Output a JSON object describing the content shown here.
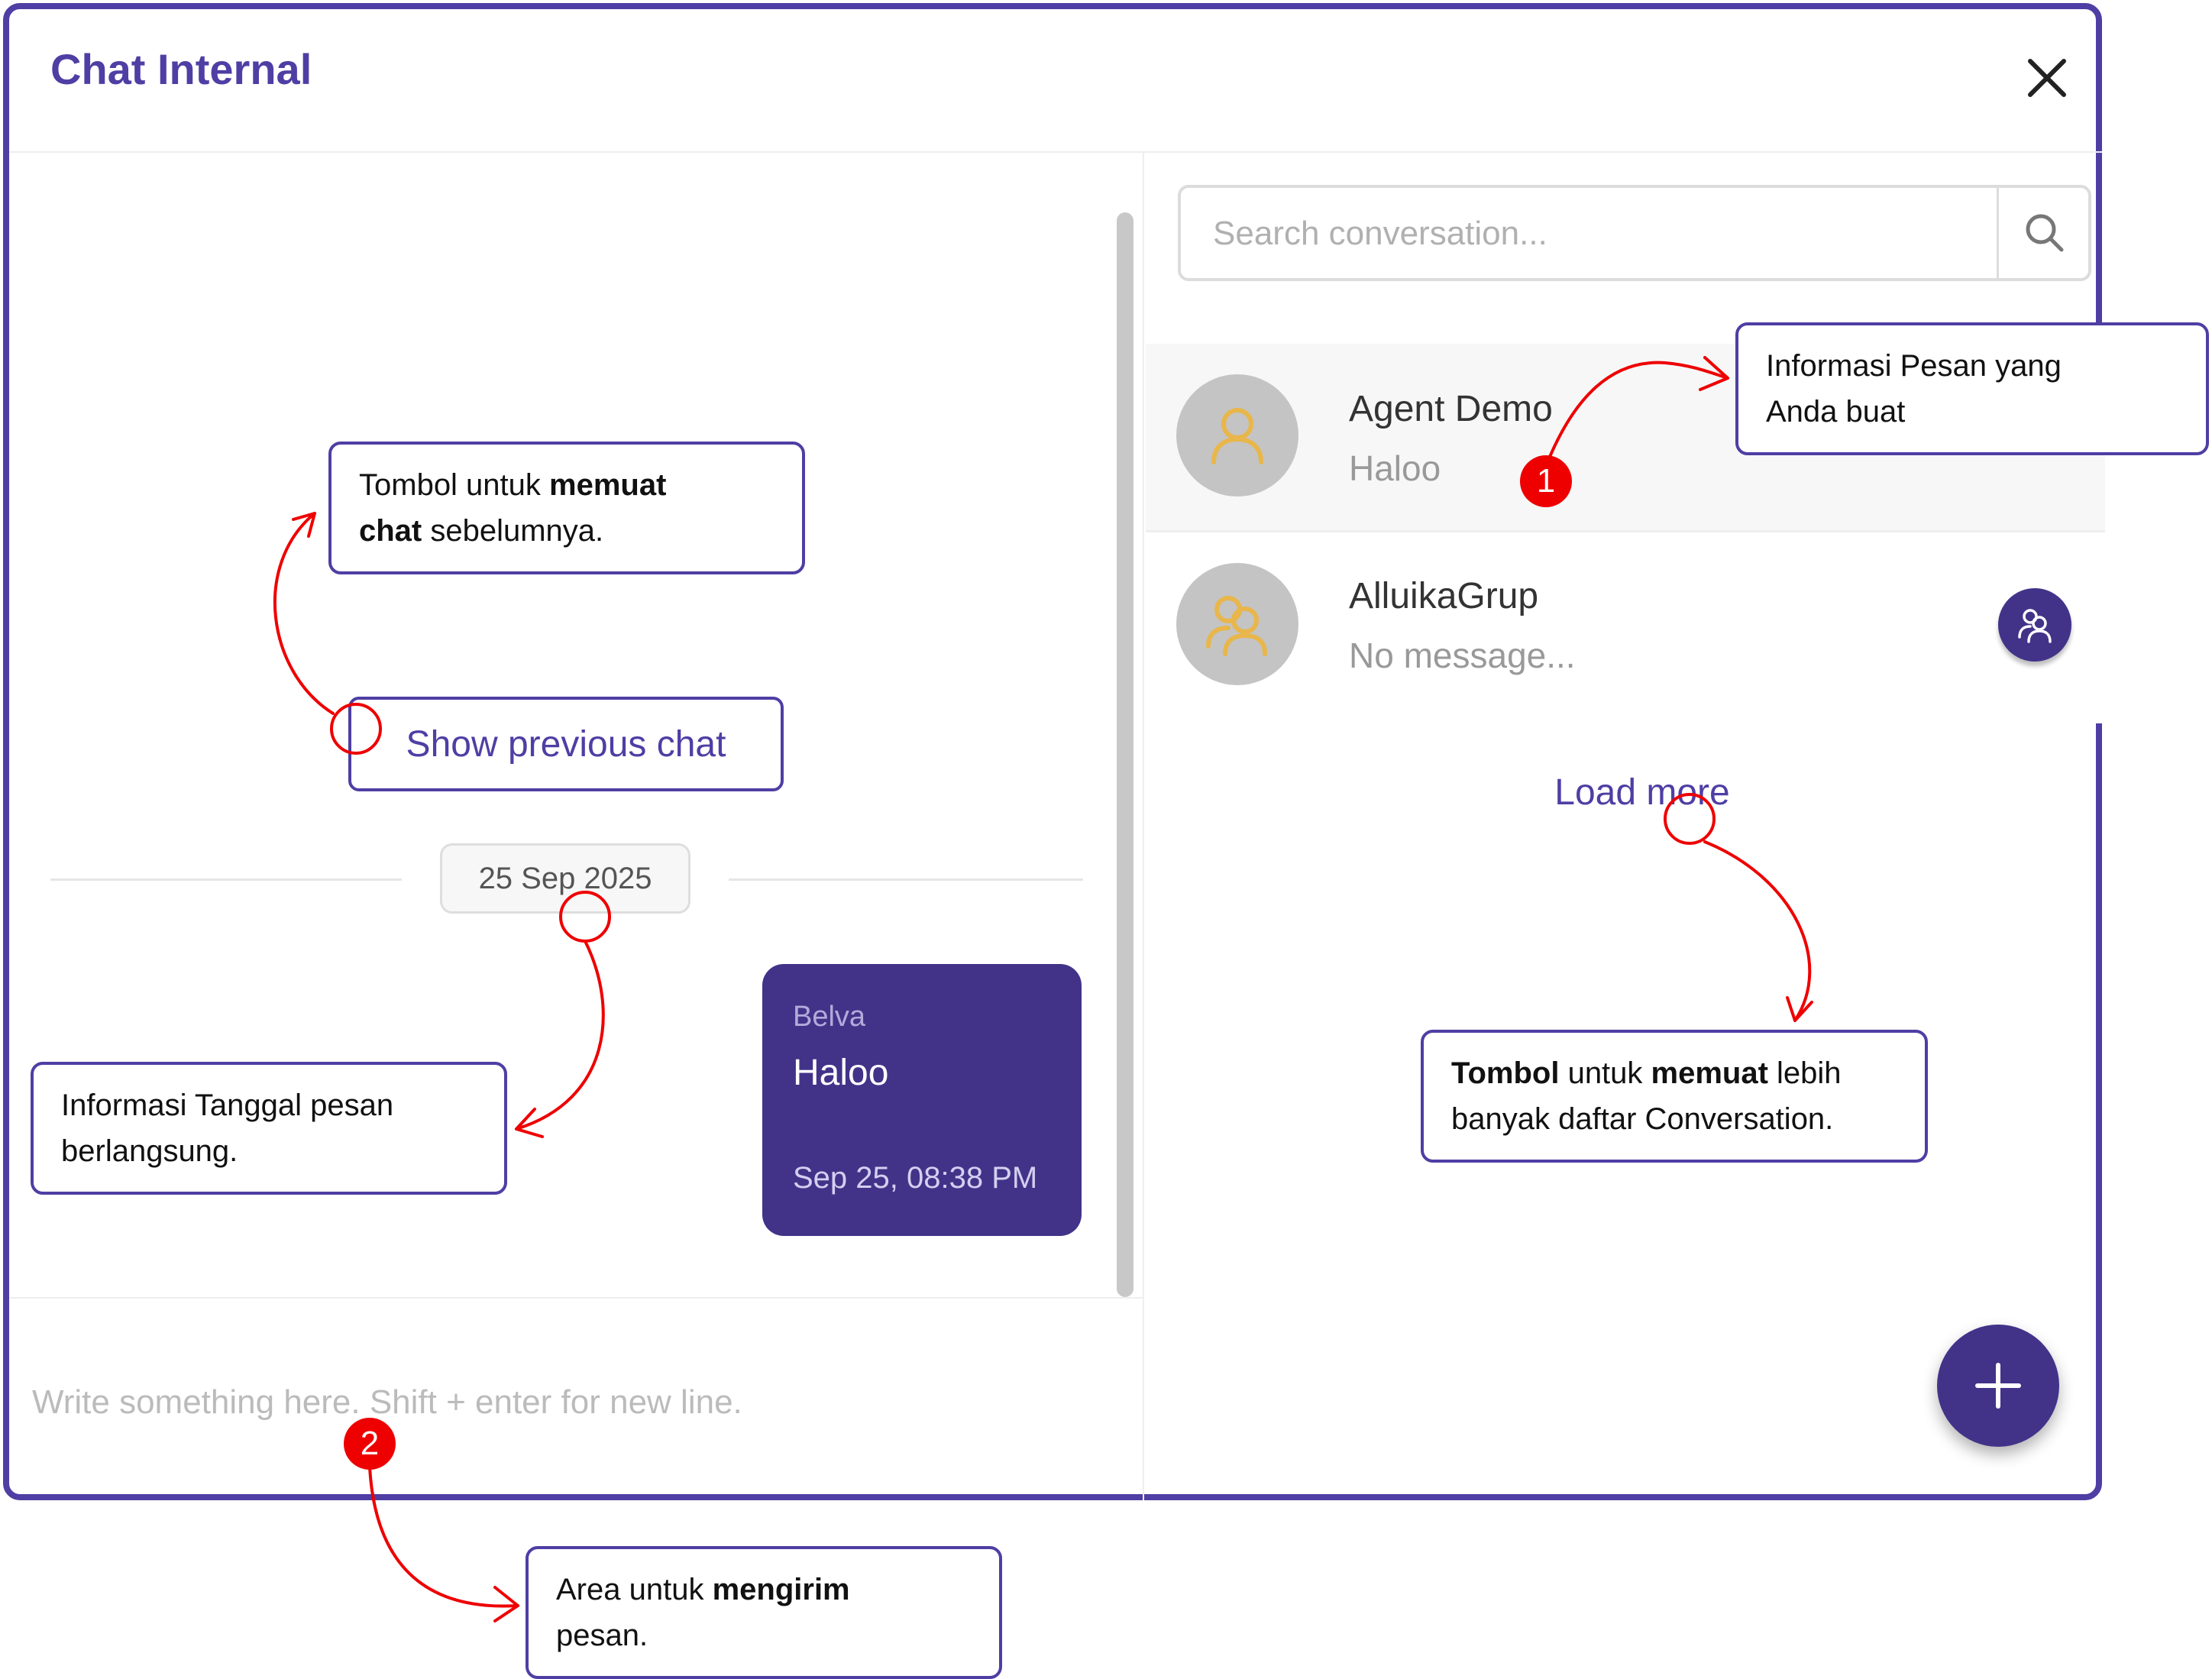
{
  "window": {
    "title": "Chat Internal",
    "close_icon": "close-icon"
  },
  "chat": {
    "show_previous_label": "Show previous chat",
    "date_badge": "25 Sep 2025",
    "message": {
      "sender": "Belva",
      "text": "Haloo",
      "time": "Sep 25, 08:38 PM"
    },
    "input_placeholder": "Write something here. Shift + enter for new line."
  },
  "conversations": {
    "search_placeholder": "Search conversation...",
    "search_icon": "search-icon",
    "items": [
      {
        "name": "Agent Demo",
        "preview": "Haloo",
        "avatar_icon": "user-icon"
      },
      {
        "name": "AlluikaGrup",
        "preview": "No message...",
        "avatar_icon": "group-icon"
      }
    ],
    "group_button_icon": "group-icon",
    "load_more_label": "Load more",
    "new_conversation_icon": "plus-icon"
  },
  "annotations": {
    "info_message": {
      "text_1": "Informasi Pesan yang",
      "text_2": "Anda buat"
    },
    "load_prev": {
      "a": "Tombol untuk ",
      "b": "memuat",
      "c": "chat",
      "d": " sebelumnya."
    },
    "date_info": {
      "text_1": "Informasi Tanggal pesan",
      "text_2": "berlangsung."
    },
    "load_more": {
      "a": "Tombol",
      "b": " untuk ",
      "c": "memuat",
      "d": " lebih",
      "e": "banyak daftar Conversation."
    },
    "send_area": {
      "a": "Area untuk ",
      "b": "mengirim",
      "c": "pesan."
    },
    "badge_1": "1",
    "badge_2": "2"
  },
  "colors": {
    "brand": "#4f3ea4",
    "bubble": "#423389",
    "annotation": "#ee0000",
    "avatar_icon": "#e8b64a"
  }
}
